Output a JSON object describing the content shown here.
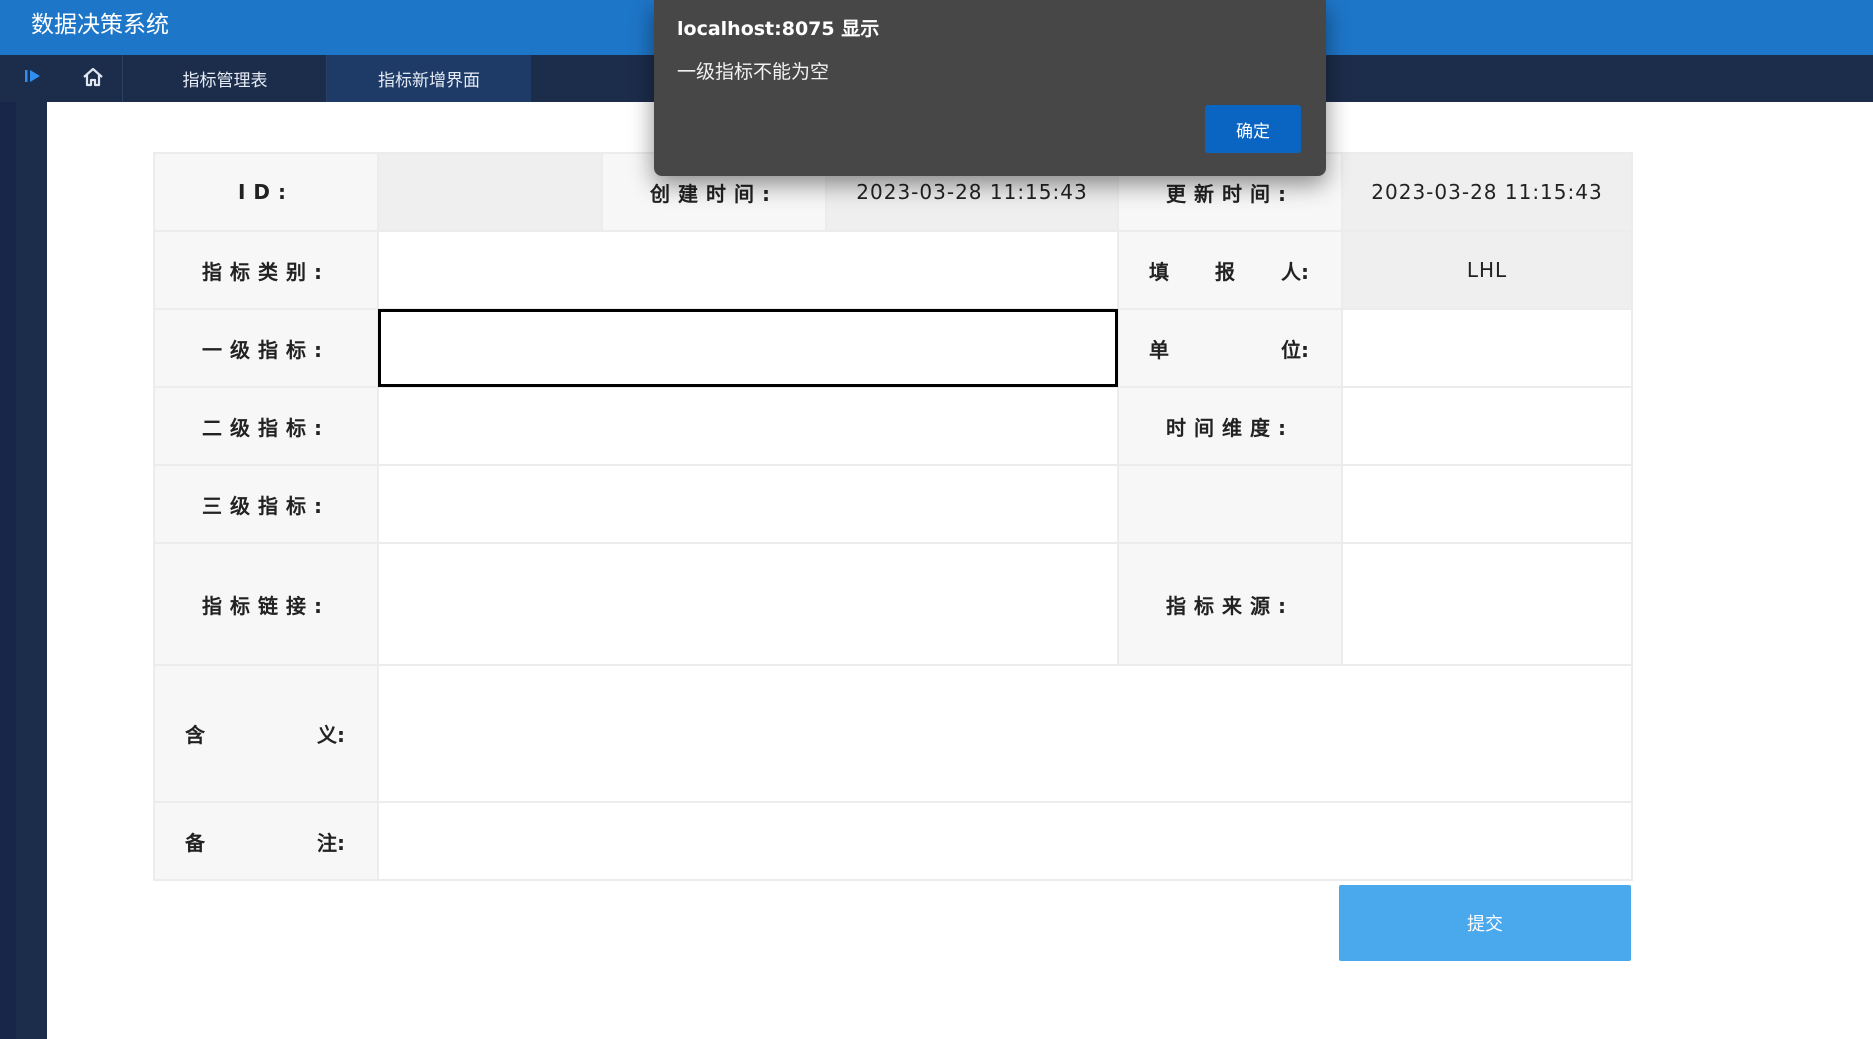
{
  "app": {
    "title": "数据决策系统"
  },
  "tabs": [
    {
      "label": "指标管理表"
    },
    {
      "label": "指标新增界面"
    }
  ],
  "form": {
    "id_label": "ID:",
    "id_value": "",
    "created_label": "创建时间:",
    "created_value": "2023-03-28 11:15:43",
    "updated_label": "更新时间:",
    "updated_value": "2023-03-28 11:15:43",
    "category_label": "指标类别:",
    "reporter_label": [
      "填",
      "报",
      "人:"
    ],
    "reporter_value": "LHL",
    "level1_label": "一级指标:",
    "unit_label": [
      "单",
      "位:"
    ],
    "level2_label": "二级指标:",
    "time_dim_label": "时间维度:",
    "level3_label": "三级指标:",
    "link_label": "指标链接:",
    "source_label": "指标来源:",
    "meaning_label": [
      "含",
      "义:"
    ],
    "remark_label": [
      "备",
      "注:"
    ],
    "submit_label": "提交"
  },
  "dialog": {
    "title": "localhost:8075 显示",
    "message": "一级指标不能为空",
    "ok_label": "确定"
  },
  "colors": {
    "header": "#1e76c9",
    "nav": "#1c2d4b",
    "submit": "#4aa8ec",
    "dialog_bg": "#474747",
    "dialog_ok": "#0a64c2"
  }
}
